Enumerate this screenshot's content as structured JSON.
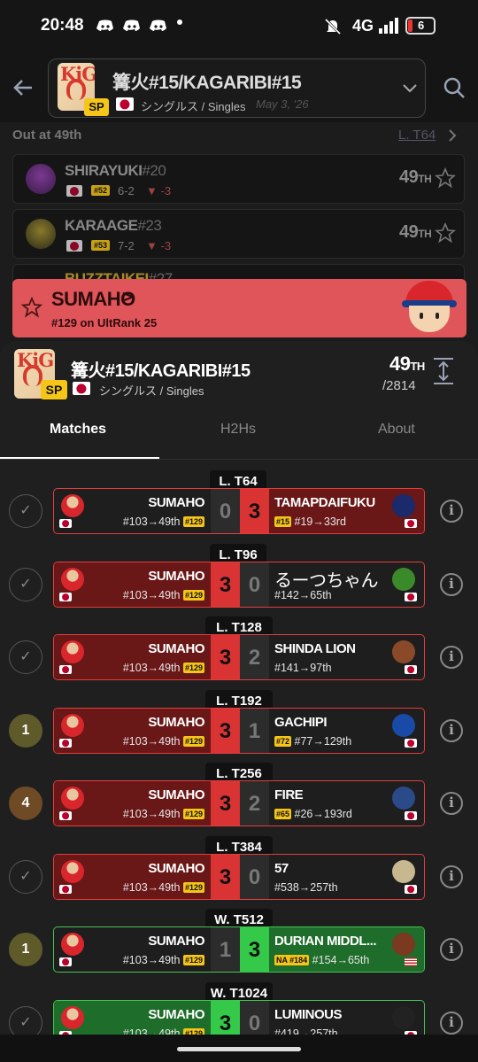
{
  "status_bar": {
    "time": "20:48",
    "network": "4G",
    "battery": "6"
  },
  "header": {
    "event_title": "篝火#15/KAGARIBI#15",
    "sp_badge": "SP",
    "category": "シングルス / Singles",
    "date": "May 3, '26"
  },
  "out_section": {
    "label": "Out at 49th",
    "link": "L. T64",
    "players": [
      {
        "name": "SHIRAYUKI",
        "tag": "#20",
        "rank_badge": "#52",
        "record": "6-2",
        "delta": "-3",
        "placing": "49",
        "suffix": "TH"
      },
      {
        "name": "KARAAGE",
        "tag": "#23",
        "rank_badge": "#53",
        "record": "7-2",
        "delta": "-3",
        "placing": "49",
        "suffix": "TH"
      },
      {
        "name": "BUZZTAIKEI",
        "tag": "#27"
      }
    ]
  },
  "banner": {
    "name": "SUMAHO",
    "chevron": ">",
    "subtitle": "#129 on UltRank 25",
    "color": "#e0555a"
  },
  "event_panel": {
    "title": "篝火#15/KAGARIBI#15",
    "sp_badge": "SP",
    "category": "シングルス / Singles",
    "placing": "49",
    "placing_suffix": "TH",
    "entrants": "/2814"
  },
  "tabs": [
    {
      "label": "Matches",
      "active": true
    },
    {
      "label": "H2Hs",
      "active": false
    },
    {
      "label": "About",
      "active": false
    }
  ],
  "matches": [
    {
      "round": "L. T64",
      "status": "✓",
      "left_name": "SUMAHO",
      "left_meta": "#103→49th",
      "left_badge": "#129",
      "left_score": "0",
      "right_score": "3",
      "right_name": "TAMAPDAIFUKU",
      "right_badge": "#15",
      "right_meta": "#19→33rd",
      "result": "loss"
    },
    {
      "round": "L. T96",
      "status": "✓",
      "left_name": "SUMAHO",
      "left_meta": "#103→49th",
      "left_badge": "#129",
      "left_score": "3",
      "right_score": "0",
      "right_name": "るーつちゃん",
      "right_badge": "",
      "right_meta": "#142→65th",
      "result": "win"
    },
    {
      "round": "L. T128",
      "status": "✓",
      "left_name": "SUMAHO",
      "left_meta": "#103→49th",
      "left_badge": "#129",
      "left_score": "3",
      "right_score": "2",
      "right_name": "SHINDA LION",
      "right_badge": "",
      "right_meta": "#141→97th",
      "result": "win"
    },
    {
      "round": "L. T192",
      "status": "1",
      "left_name": "SUMAHO",
      "left_meta": "#103→49th",
      "left_badge": "#129",
      "left_score": "3",
      "right_score": "1",
      "right_name": "GACHIPI",
      "right_badge": "#72",
      "right_meta": "#77→129th",
      "result": "win"
    },
    {
      "round": "L. T256",
      "status": "4",
      "left_name": "SUMAHO",
      "left_meta": "#103→49th",
      "left_badge": "#129",
      "left_score": "3",
      "right_score": "2",
      "right_name": "FIRE",
      "right_badge": "#65",
      "right_meta": "#26→193rd",
      "result": "win"
    },
    {
      "round": "L. T384",
      "status": "✓",
      "left_name": "SUMAHO",
      "left_meta": "#103→49th",
      "left_badge": "#129",
      "left_score": "3",
      "right_score": "0",
      "right_name": "57",
      "right_badge": "",
      "right_meta": "#538→257th",
      "result": "win"
    },
    {
      "round": "W. T512",
      "status": "1",
      "left_name": "SUMAHO",
      "left_meta": "#103→49th",
      "left_badge": "#129",
      "left_score": "1",
      "right_score": "3",
      "right_name": "DURIAN MIDDL...",
      "right_badge": "NA #184",
      "right_meta": "#154→65th",
      "result": "gloss"
    },
    {
      "round": "W. T1024",
      "status": "✓",
      "left_name": "SUMAHO",
      "left_meta": "#103→49th",
      "left_badge": "#129",
      "left_score": "3",
      "right_score": "0",
      "right_name": "LUMINOUS",
      "right_badge": "",
      "right_meta": "#419→257th",
      "result": "gwin"
    }
  ]
}
